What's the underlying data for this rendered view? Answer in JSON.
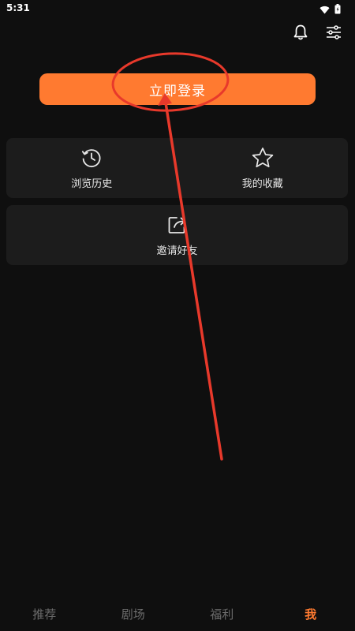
{
  "status_bar": {
    "time": "5:31",
    "icons": [
      "wifi-icon",
      "battery-icon"
    ]
  },
  "header": {
    "icons": [
      "bell-icon",
      "settings-sliders-icon"
    ]
  },
  "login": {
    "label": "立即登录",
    "color": "#ff7a30"
  },
  "menu": {
    "history": {
      "label": "浏览历史",
      "icon": "history-clock-icon"
    },
    "favorites": {
      "label": "我的收藏",
      "icon": "star-icon"
    },
    "invite": {
      "label": "邀请好友",
      "icon": "share-icon"
    }
  },
  "bottom_nav": {
    "tabs": [
      {
        "label": "推荐",
        "active": false
      },
      {
        "label": "剧场",
        "active": false
      },
      {
        "label": "福利",
        "active": false
      },
      {
        "label": "我",
        "active": true
      }
    ],
    "active_color": "#ff7a30"
  },
  "annotation": {
    "color": "#e8392b",
    "shapes": [
      "ellipse-circle",
      "arrow"
    ]
  }
}
